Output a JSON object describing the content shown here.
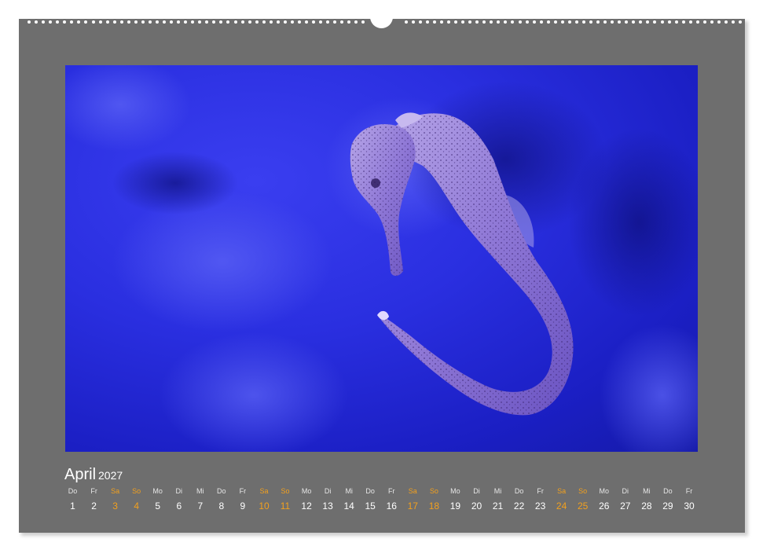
{
  "calendar": {
    "month": "April",
    "year": "2027",
    "photo_subject": "seahorse",
    "colors": {
      "sheet": "#6e6e6e",
      "weekend": "#f2a01e",
      "text": "#ffffff",
      "photo_bg": "#2a2fe0"
    },
    "days": [
      {
        "dow": "Do",
        "num": "1",
        "weekend": false
      },
      {
        "dow": "Fr",
        "num": "2",
        "weekend": false
      },
      {
        "dow": "Sa",
        "num": "3",
        "weekend": true
      },
      {
        "dow": "So",
        "num": "4",
        "weekend": true
      },
      {
        "dow": "Mo",
        "num": "5",
        "weekend": false
      },
      {
        "dow": "Di",
        "num": "6",
        "weekend": false
      },
      {
        "dow": "Mi",
        "num": "7",
        "weekend": false
      },
      {
        "dow": "Do",
        "num": "8",
        "weekend": false
      },
      {
        "dow": "Fr",
        "num": "9",
        "weekend": false
      },
      {
        "dow": "Sa",
        "num": "10",
        "weekend": true
      },
      {
        "dow": "So",
        "num": "11",
        "weekend": true
      },
      {
        "dow": "Mo",
        "num": "12",
        "weekend": false
      },
      {
        "dow": "Di",
        "num": "13",
        "weekend": false
      },
      {
        "dow": "Mi",
        "num": "14",
        "weekend": false
      },
      {
        "dow": "Do",
        "num": "15",
        "weekend": false
      },
      {
        "dow": "Fr",
        "num": "16",
        "weekend": false
      },
      {
        "dow": "Sa",
        "num": "17",
        "weekend": true
      },
      {
        "dow": "So",
        "num": "18",
        "weekend": true
      },
      {
        "dow": "Mo",
        "num": "19",
        "weekend": false
      },
      {
        "dow": "Di",
        "num": "20",
        "weekend": false
      },
      {
        "dow": "Mi",
        "num": "21",
        "weekend": false
      },
      {
        "dow": "Do",
        "num": "22",
        "weekend": false
      },
      {
        "dow": "Fr",
        "num": "23",
        "weekend": false
      },
      {
        "dow": "Sa",
        "num": "24",
        "weekend": true
      },
      {
        "dow": "So",
        "num": "25",
        "weekend": true
      },
      {
        "dow": "Mo",
        "num": "26",
        "weekend": false
      },
      {
        "dow": "Di",
        "num": "27",
        "weekend": false
      },
      {
        "dow": "Mi",
        "num": "28",
        "weekend": false
      },
      {
        "dow": "Do",
        "num": "29",
        "weekend": false
      },
      {
        "dow": "Fr",
        "num": "30",
        "weekend": false
      }
    ]
  }
}
